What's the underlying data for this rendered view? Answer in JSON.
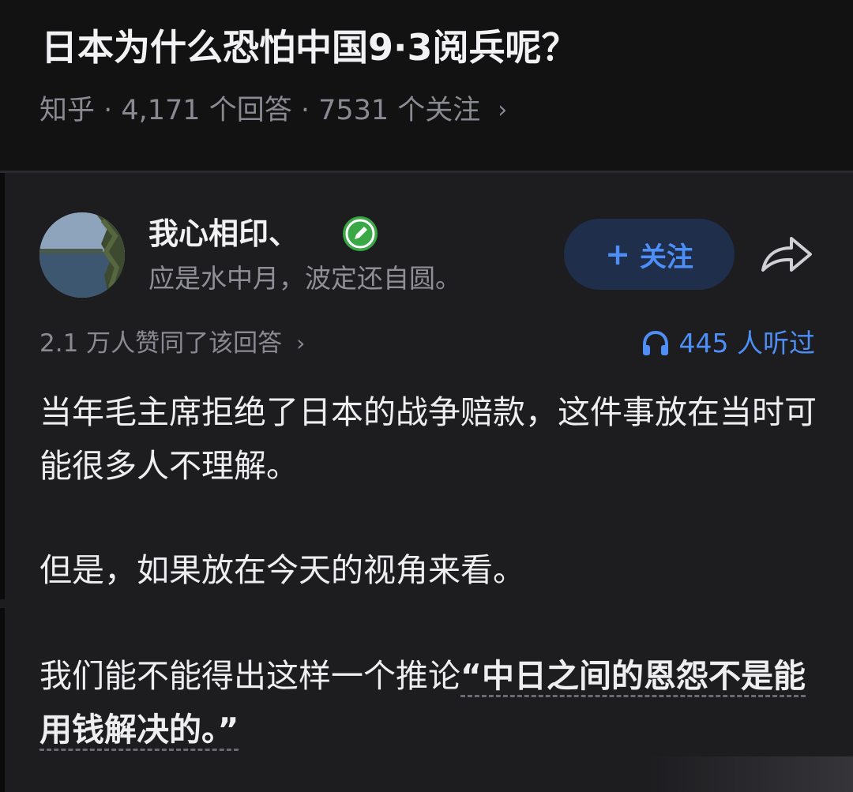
{
  "question": {
    "title": "日本为什么恐怕中国9·3阅兵呢？",
    "meta": "知乎 · 4,171 个回答 · 7531 个关注"
  },
  "author": {
    "name": "我心相印、",
    "bio": "应是水中月，波定还自圆。",
    "follow_label": "关注"
  },
  "stats": {
    "votes": "2.1 万人赞同了该回答",
    "listens": "445 人听过"
  },
  "content": {
    "p1": "当年毛主席拒绝了日本的战争赔款，这件事放在当时可能很多人不理解。",
    "p2": "但是，如果放在今天的视角来看。",
    "p3_prefix": "我们能不能得出这样一个推论",
    "p3_linked": "“中日之间的恩怨不是能用钱解决的。”"
  },
  "colors": {
    "background": "#121213",
    "card": "#1d1d20",
    "accent": "#4d8ef7",
    "badge": "#3aa844"
  },
  "icons": [
    "chevron-right-icon",
    "verified-badge-icon",
    "plus-icon",
    "share-icon",
    "headphones-icon"
  ]
}
